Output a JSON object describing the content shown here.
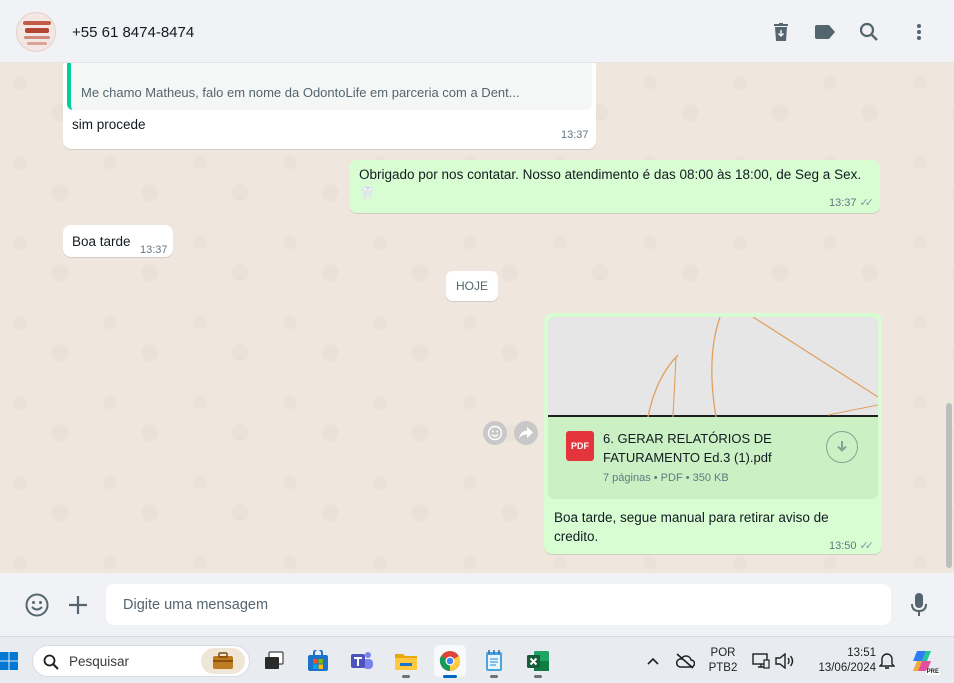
{
  "header": {
    "contact_name": "+55 61 8474-8474",
    "icons": [
      "delete-icon",
      "label-icon",
      "search-icon",
      "menu-icon"
    ]
  },
  "messages": {
    "quoted_text": "Me chamo Matheus, falo em nome da OdontoLife em parceria com a Dent...",
    "msg1_text": "sim procede",
    "msg1_time": "13:37",
    "msg2_text": "Obrigado por nos contatar. Nosso atendimento é das 08:00 às 18:00, de Seg a Sex.🦷",
    "msg2_time": "13:37",
    "msg3_text": "Boa tarde",
    "msg3_time": "13:37",
    "day_chip": "HOJE",
    "doc_badge": "PDF",
    "doc_name": "6. GERAR RELATÓRIOS DE FATURAMENTO Ed.3 (1).pdf",
    "doc_meta": "7 páginas • PDF • 350 KB",
    "msg4_caption": "Boa tarde,  segue manual para retirar aviso de credito.",
    "msg4_time": "13:50",
    "read_ticks": "✓✓"
  },
  "composer": {
    "placeholder": "Digite uma mensagem"
  },
  "taskbar": {
    "search_label": "Pesquisar",
    "lang_line1": "POR",
    "lang_line2": "PTB2",
    "clock_time": "13:51",
    "clock_date": "13/06/2024",
    "copilot_badge": "PRE",
    "apps": [
      "task-view",
      "store",
      "teams",
      "file-explorer",
      "chrome",
      "notepad",
      "excel"
    ]
  },
  "colors": {
    "outgoing_bubble": "#d9fdd3",
    "incoming_bubble": "#ffffff",
    "chat_bg": "#efe7dd",
    "accent": "#06cf9c",
    "pdf_red": "#e5353c"
  }
}
